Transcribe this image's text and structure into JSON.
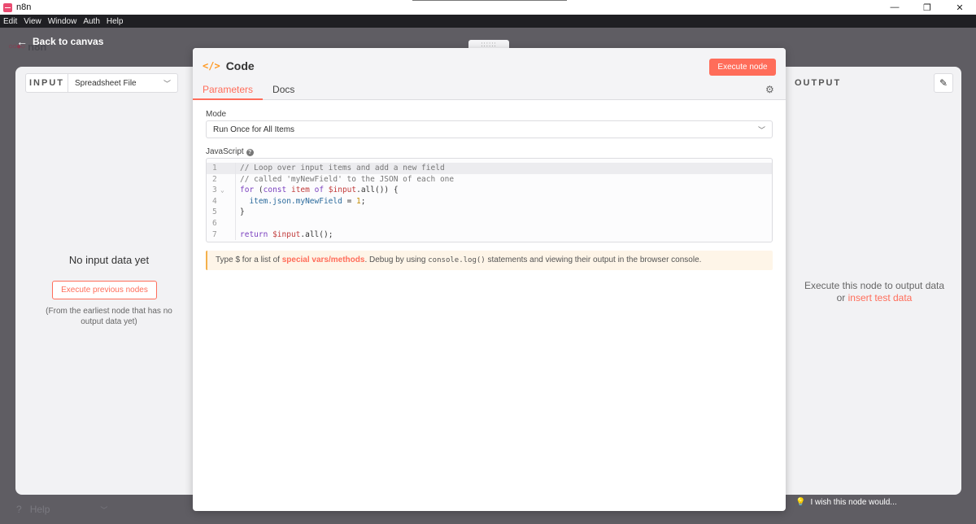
{
  "window": {
    "title": "n8n",
    "controls": [
      "—",
      "❐",
      "✕"
    ]
  },
  "menu": [
    "Edit",
    "View",
    "Window",
    "Auth",
    "Help"
  ],
  "background": {
    "logo_text": "n8n",
    "back_label": "Back to canvas",
    "drag_handle": "::::::",
    "help_label": "Help",
    "wish_label": "I wish this node would..."
  },
  "input_panel": {
    "label": "INPUT",
    "selected_source": "Spreadsheet File",
    "no_data_title": "No input data yet",
    "execute_previous_label": "Execute previous nodes",
    "hint": "(From the earliest node that has no output data yet)"
  },
  "output_panel": {
    "label": "OUTPUT",
    "message": "Execute this node to output data",
    "or_text": "or",
    "insert_link": "insert test data"
  },
  "node": {
    "title": "Code",
    "execute_label": "Execute node",
    "tabs": [
      {
        "label": "Parameters",
        "active": true
      },
      {
        "label": "Docs",
        "active": false
      }
    ],
    "mode_label": "Mode",
    "mode_value": "Run Once for All Items",
    "js_label": "JavaScript",
    "code_lines": [
      {
        "num": "1",
        "text": "// Loop over input items and add a new field"
      },
      {
        "num": "2",
        "text": "// called 'myNewField' to the JSON of each one"
      },
      {
        "num": "3",
        "text": "for (const item of $input.all()) {"
      },
      {
        "num": "4",
        "text": "  item.json.myNewField = 1;"
      },
      {
        "num": "5",
        "text": "}"
      },
      {
        "num": "6",
        "text": ""
      },
      {
        "num": "7",
        "text": "return $input.all();"
      }
    ],
    "notice": {
      "prefix": "Type $ for a list of ",
      "link": "special vars/methods",
      "middle": ". Debug by using ",
      "code": "console.log()",
      "suffix": " statements and viewing their output in the browser console."
    }
  },
  "colors": {
    "accent": "#ff6d5a",
    "code_icon": "#ff9922",
    "notice_bg": "#fef5e8"
  }
}
